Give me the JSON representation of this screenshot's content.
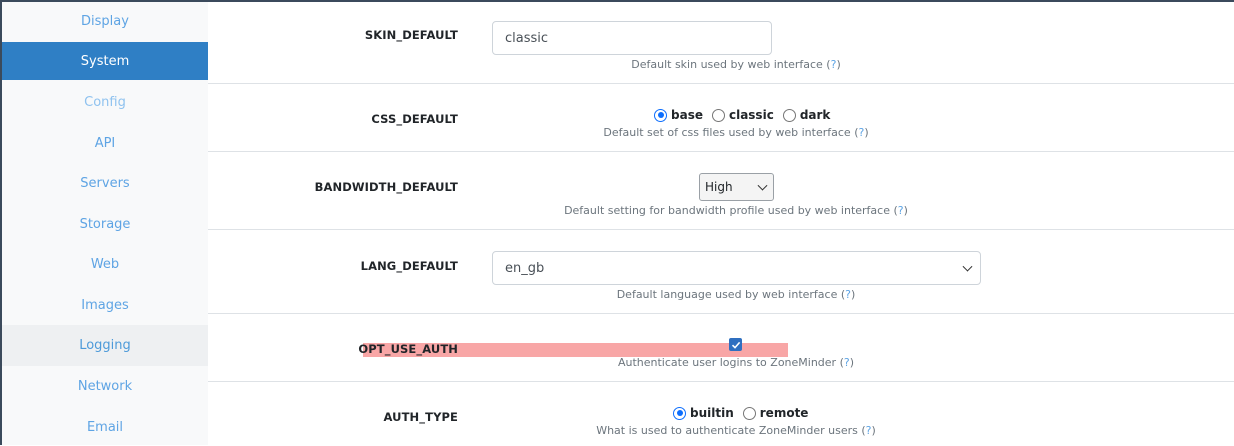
{
  "sidebar": {
    "items": [
      {
        "label": "Display"
      },
      {
        "label": "System"
      },
      {
        "label": "Config"
      },
      {
        "label": "API"
      },
      {
        "label": "Servers"
      },
      {
        "label": "Storage"
      },
      {
        "label": "Web"
      },
      {
        "label": "Images"
      },
      {
        "label": "Logging"
      },
      {
        "label": "Network"
      },
      {
        "label": "Email"
      }
    ],
    "active": "System"
  },
  "settings": {
    "skin_default": {
      "label": "SKIN_DEFAULT",
      "value": "classic",
      "help": "Default skin used by web interface",
      "help_link": "?"
    },
    "css_default": {
      "label": "CSS_DEFAULT",
      "options": [
        "base",
        "classic",
        "dark"
      ],
      "selected": "base",
      "help": "Default set of css files used by web interface",
      "help_link": "?"
    },
    "bandwidth_default": {
      "label": "BANDWIDTH_DEFAULT",
      "value": "High",
      "help": "Default setting for bandwidth profile used by web interface",
      "help_link": "?"
    },
    "lang_default": {
      "label": "LANG_DEFAULT",
      "value": "en_gb",
      "help": "Default language used by web interface",
      "help_link": "?"
    },
    "opt_use_auth": {
      "label": "OPT_USE_AUTH",
      "checked": true,
      "help": "Authenticate user logins to ZoneMinder",
      "help_link": "?"
    },
    "auth_type": {
      "label": "AUTH_TYPE",
      "options": [
        "builtin",
        "remote"
      ],
      "selected": "builtin",
      "help": "What is used to authenticate ZoneMinder users",
      "help_link": "?"
    }
  },
  "colors": {
    "accent": "#2f7fc5",
    "link": "#5ea4e4",
    "highlight": "#f8a6a6",
    "checkbox": "#2f6fc0"
  }
}
